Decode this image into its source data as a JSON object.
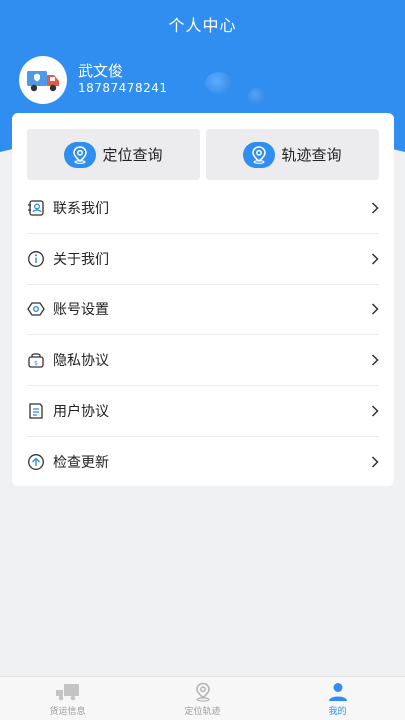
{
  "header": {
    "title": "个人中心"
  },
  "user": {
    "name": "武文俊",
    "phone": "18787478241"
  },
  "quick_actions": [
    {
      "label": "定位查询",
      "icon": "location-pin-icon"
    },
    {
      "label": "轨迹查询",
      "icon": "track-pin-icon"
    }
  ],
  "menu": [
    {
      "label": "联系我们",
      "icon": "contact-icon"
    },
    {
      "label": "关于我们",
      "icon": "info-icon"
    },
    {
      "label": "账号设置",
      "icon": "settings-icon"
    },
    {
      "label": "隐私协议",
      "icon": "privacy-icon"
    },
    {
      "label": "用户协议",
      "icon": "agreement-icon"
    },
    {
      "label": "检查更新",
      "icon": "update-icon"
    }
  ],
  "tabs": [
    {
      "label": "货运信息",
      "icon": "truck-icon",
      "active": false
    },
    {
      "label": "定位轨迹",
      "icon": "location-pin-icon",
      "active": false
    },
    {
      "label": "我的",
      "icon": "person-icon",
      "active": true
    }
  ],
  "colors": {
    "accent": "#2f8ef0",
    "background": "#f0f1f3"
  }
}
